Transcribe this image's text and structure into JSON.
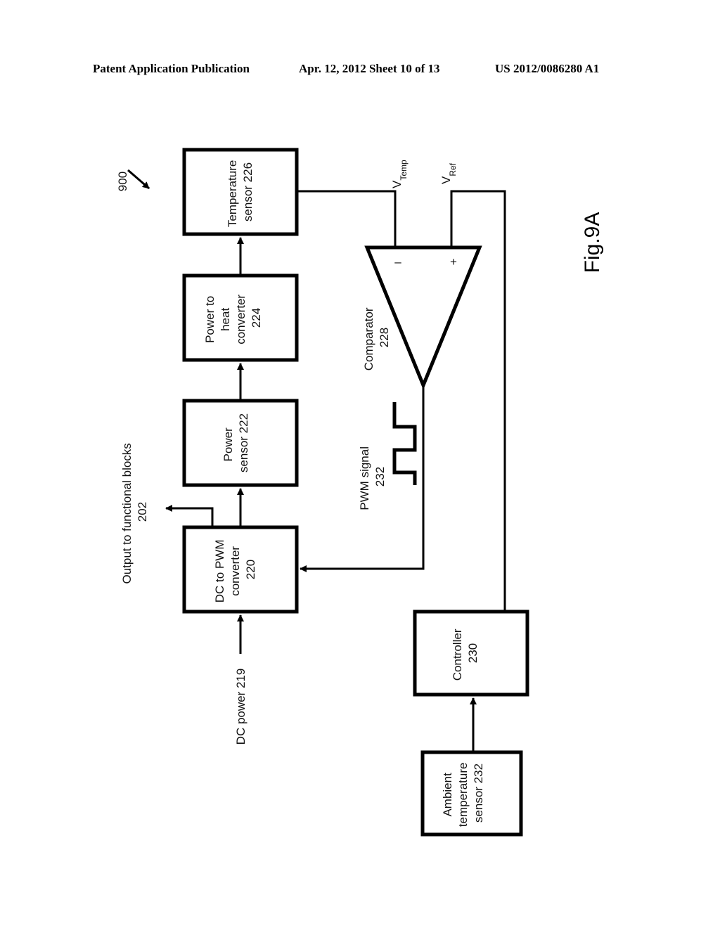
{
  "header": {
    "publication": "Patent Application Publication",
    "date_sheet": "Apr. 12, 2012  Sheet 10 of 13",
    "patent_number": "US 2012/0086280 A1"
  },
  "figure": {
    "label": "Fig.9A",
    "reference": "900"
  },
  "blocks": {
    "temperature_sensor": [
      "Temperature",
      "sensor 226"
    ],
    "power_to_heat": [
      "Power to",
      "heat",
      "converter",
      "224"
    ],
    "power_sensor": [
      "Power",
      "sensor 222"
    ],
    "dc_to_pwm": [
      "DC to PWM",
      "converter",
      "220"
    ],
    "controller": [
      "Controller",
      "230"
    ],
    "ambient_sensor": [
      "Ambient",
      "temperature",
      "sensor 232"
    ]
  },
  "comparator": {
    "label": [
      "Comparator",
      "228"
    ],
    "minus": "–",
    "plus": "+"
  },
  "signals": {
    "v_temp_main": "V",
    "v_temp_sub": "Temp",
    "v_ref_main": "V",
    "v_ref_sub": "Ref",
    "pwm": [
      "PWM signal",
      "232"
    ],
    "output": [
      "Output to  functional blocks",
      "202"
    ],
    "dc_power": "DC power 219"
  }
}
